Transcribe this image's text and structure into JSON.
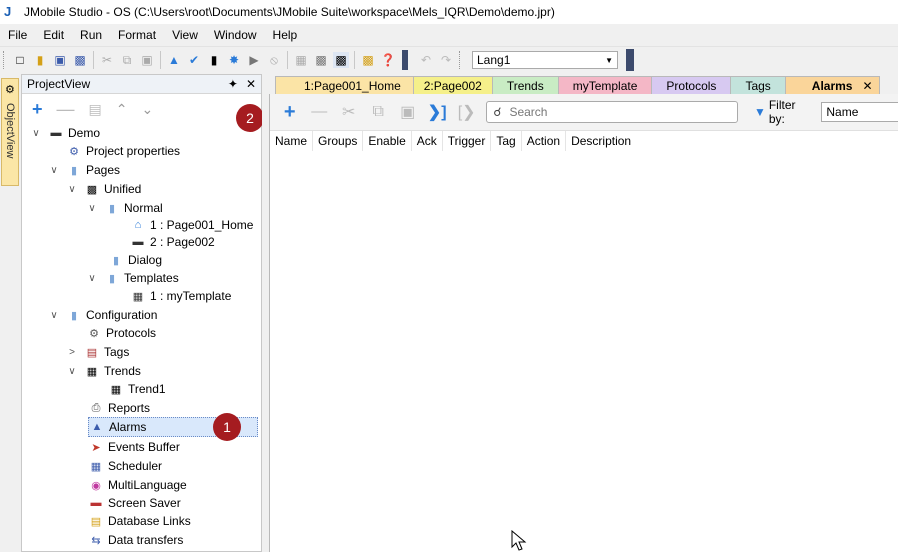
{
  "window": {
    "title": "JMobile Studio - OS (C:\\Users\\root\\Documents\\JMobile Suite\\workspace\\Mels_IQR\\Demo\\demo.jpr)"
  },
  "menu": [
    "File",
    "Edit",
    "Run",
    "Format",
    "View",
    "Window",
    "Help"
  ],
  "toolbar": {
    "language": "Lang1"
  },
  "side_tab": "ObjectView",
  "project_view": {
    "title": "ProjectView",
    "tree": [
      {
        "label": "Demo",
        "icon": "monitor-icon"
      },
      {
        "label": "Project properties",
        "icon": "gear-icon"
      },
      {
        "label": "Pages",
        "icon": "folder-icon"
      },
      {
        "label": "Unified",
        "icon": "pages-icon"
      },
      {
        "label": "Normal",
        "icon": "folder-icon"
      },
      {
        "label": "1 : Page001_Home",
        "icon": "home-icon"
      },
      {
        "label": "2 : Page002",
        "icon": "page-icon"
      },
      {
        "label": "Dialog",
        "icon": "folder-icon"
      },
      {
        "label": "Templates",
        "icon": "folder-icon"
      },
      {
        "label": "1 : myTemplate",
        "icon": "template-icon"
      },
      {
        "label": "Configuration",
        "icon": "folder-icon"
      },
      {
        "label": "Protocols",
        "icon": "protocol-icon"
      },
      {
        "label": "Tags",
        "icon": "tags-icon"
      },
      {
        "label": "Trends",
        "icon": "trend-icon"
      },
      {
        "label": "Trend1",
        "icon": "trend-icon"
      },
      {
        "label": "Reports",
        "icon": "printer-icon"
      },
      {
        "label": "Alarms",
        "icon": "alarm-icon"
      },
      {
        "label": "Events Buffer",
        "icon": "pin-icon"
      },
      {
        "label": "Scheduler",
        "icon": "calendar-icon"
      },
      {
        "label": "MultiLanguage",
        "icon": "language-icon"
      },
      {
        "label": "Screen Saver",
        "icon": "screensaver-icon"
      },
      {
        "label": "Database Links",
        "icon": "database-icon"
      },
      {
        "label": "Data transfers",
        "icon": "transfer-icon"
      }
    ]
  },
  "badges": {
    "one": "1",
    "two": "2"
  },
  "tabs": [
    {
      "label": "1:Page001_Home",
      "color": "#fbe4a6"
    },
    {
      "label": "2:Page002",
      "color": "#f5f08a"
    },
    {
      "label": "Trends",
      "color": "#c9ecc4"
    },
    {
      "label": "myTemplate",
      "color": "#f4b7c6"
    },
    {
      "label": "Protocols",
      "color": "#d7c9f1"
    },
    {
      "label": "Tags",
      "color": "#c3e3dc"
    },
    {
      "label": "Alarms",
      "color": "#fad59a"
    }
  ],
  "editor": {
    "search_placeholder": "Search",
    "filter_label": "Filter by:",
    "filter_value": "Name",
    "columns": [
      "Name",
      "Groups",
      "Enable",
      "Ack",
      "Trigger",
      "Tag",
      "Action",
      "Description"
    ]
  }
}
